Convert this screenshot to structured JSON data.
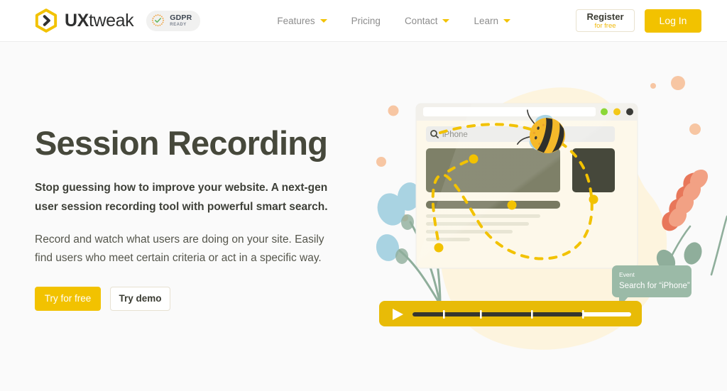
{
  "header": {
    "logo": {
      "icon": "hexagon-chevron-logo-icon",
      "brand_bold": "UX",
      "brand_regular": "tweak"
    },
    "gdpr_badge": {
      "icon": "gdpr-check-ring-icon",
      "title": "GDPR",
      "subtitle": "READY"
    },
    "nav": [
      {
        "label": "Features",
        "has_dropdown": true,
        "icon": "chevron-down-icon"
      },
      {
        "label": "Pricing",
        "has_dropdown": false,
        "icon": ""
      },
      {
        "label": "Contact",
        "has_dropdown": true,
        "icon": "chevron-down-icon"
      },
      {
        "label": "Learn",
        "has_dropdown": true,
        "icon": "chevron-down-icon"
      }
    ],
    "register": {
      "label": "Register",
      "sublabel": "for free"
    },
    "login": {
      "label": "Log In"
    }
  },
  "hero": {
    "title": "Session Recording",
    "lead": "Stop guessing how to improve your website. A next-gen user session recording tool with powerful smart search.",
    "body": "Record and watch what users are doing on your site. Easily find users who meet certain criteria or act in a specific way.",
    "primary_cta": "Try for free",
    "secondary_cta": "Try demo"
  },
  "illustration": {
    "browser": {
      "url_bar_value": "",
      "window_dots": [
        "#7ed321",
        "#f2c200",
        "#3a3a36"
      ],
      "search": {
        "icon": "search-icon",
        "value": "iPhone"
      }
    },
    "tooltip": {
      "kicker": "Event",
      "text": "Search for \"iPhone\""
    },
    "player": {
      "play_icon": "play-icon",
      "progress_percent": 78,
      "markers": [
        14,
        34,
        55,
        78
      ]
    },
    "bee_icon": "bee-icon",
    "colors": {
      "accent": "#f2c200",
      "heading": "#46483b",
      "page_bg": "#fafafa",
      "tooltip_bg": "#9bbaa7",
      "blob": "#fdf6e0",
      "plant_coral": "#e8775a",
      "plant_blue": "#a9d3e2",
      "stem_green": "#8fae9b",
      "dot_peach": "#f6c7a5"
    }
  }
}
